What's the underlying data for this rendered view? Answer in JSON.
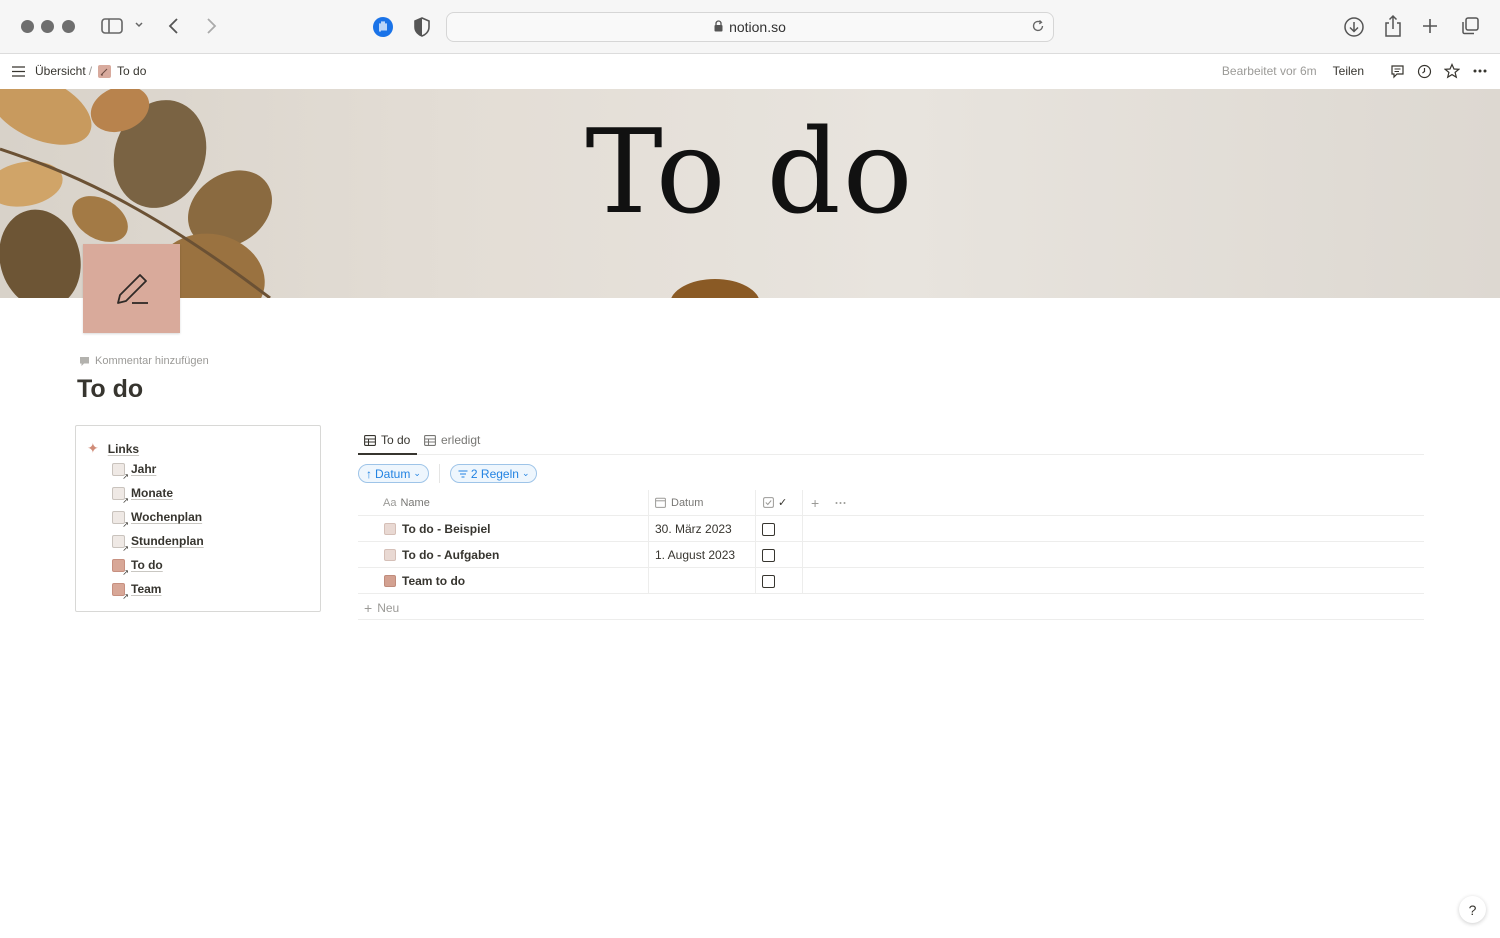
{
  "browser": {
    "url": "notion.so"
  },
  "topbar": {
    "breadcrumb_root": "Übersicht",
    "breadcrumb_sep": "/",
    "breadcrumb_page": "To do",
    "edited": "Bearbeitet vor 6m",
    "share": "Teilen"
  },
  "cover": {
    "title": "To do"
  },
  "page": {
    "add_comment": "Kommentar hinzufügen",
    "title": "To do"
  },
  "links": {
    "heading": "Links",
    "items": [
      {
        "label": "Jahr",
        "icon": "page-link-icon"
      },
      {
        "label": "Monate",
        "icon": "page-link-icon"
      },
      {
        "label": "Wochenplan",
        "icon": "page-link-icon"
      },
      {
        "label": "Stundenplan",
        "icon": "page-link-icon"
      },
      {
        "label": "To do",
        "icon": "page-link-icon"
      },
      {
        "label": "Team",
        "icon": "page-link-icon"
      }
    ]
  },
  "database": {
    "tabs": [
      {
        "label": "To do",
        "active": true
      },
      {
        "label": "erledigt",
        "active": false
      }
    ],
    "sort_chip": "Datum",
    "filter_chip": "2 Regeln",
    "columns": {
      "name": "Name",
      "name_prefix": "Aa",
      "date": "Datum",
      "check": "✓"
    },
    "rows": [
      {
        "name": "To do - Beispiel",
        "date": "30. März 2023",
        "done": false
      },
      {
        "name": "To do - Aufgaben",
        "date": "1. August 2023",
        "done": false
      },
      {
        "name": "Team to do",
        "date": "",
        "done": false
      }
    ],
    "new_label": "Neu"
  },
  "help": "?",
  "colors": {
    "accent": "#2383e2",
    "page_icon": "#d9aa9b",
    "text": "#37352f"
  }
}
